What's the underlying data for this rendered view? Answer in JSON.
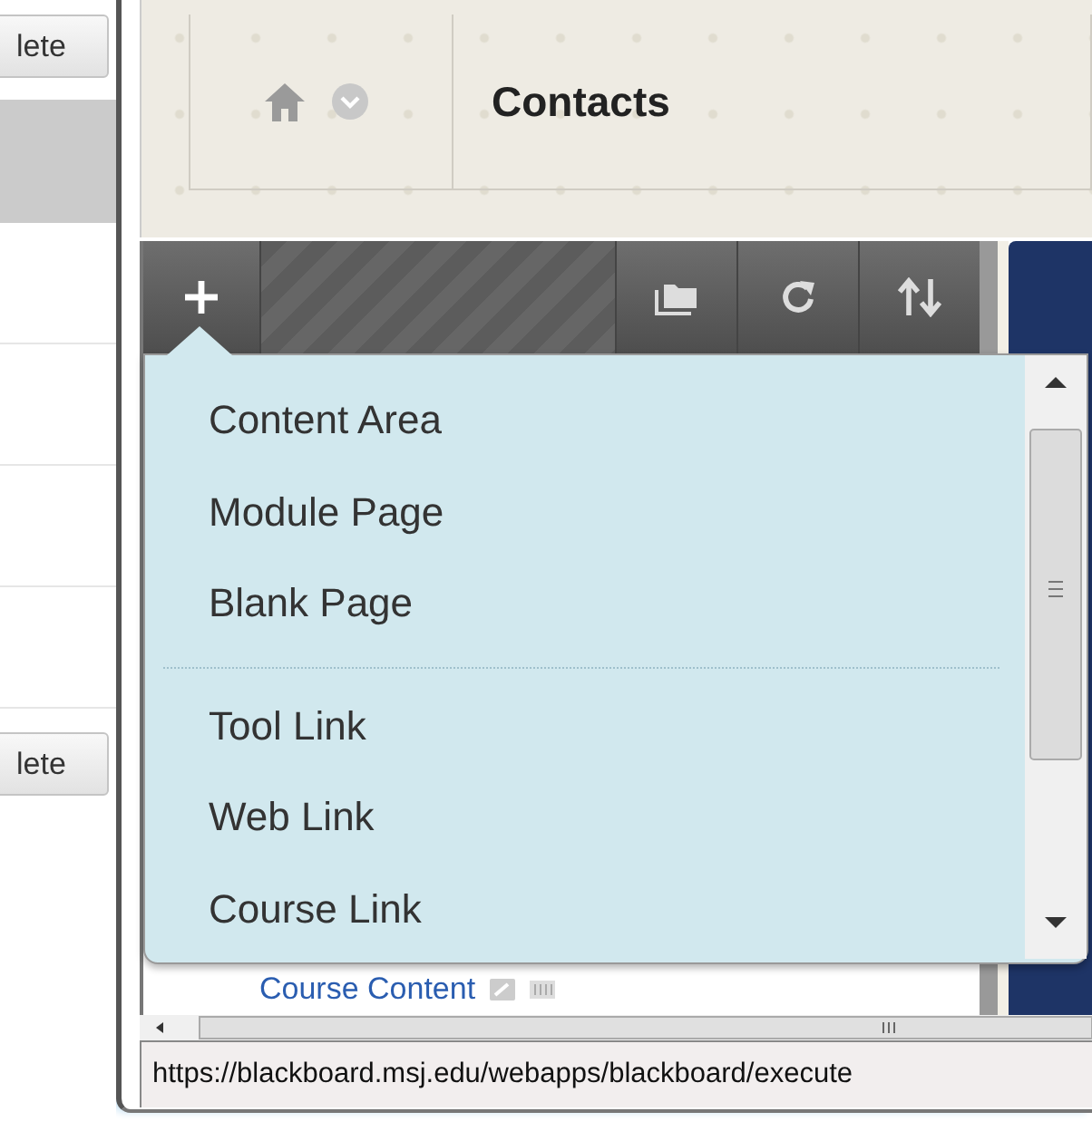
{
  "background_page": {
    "buttons": [
      "lete",
      "lete"
    ]
  },
  "header": {
    "title": "Contacts"
  },
  "add_menu": {
    "groups": [
      [
        "Content Area",
        "Module Page",
        "Blank Page"
      ],
      [
        "Tool Link",
        "Web Link",
        "Course Link"
      ]
    ]
  },
  "course_menu": {
    "items": [
      "Course Content"
    ]
  },
  "status_bar": {
    "url": "https://blackboard.msj.edu/webapps/blackboard/execute"
  }
}
